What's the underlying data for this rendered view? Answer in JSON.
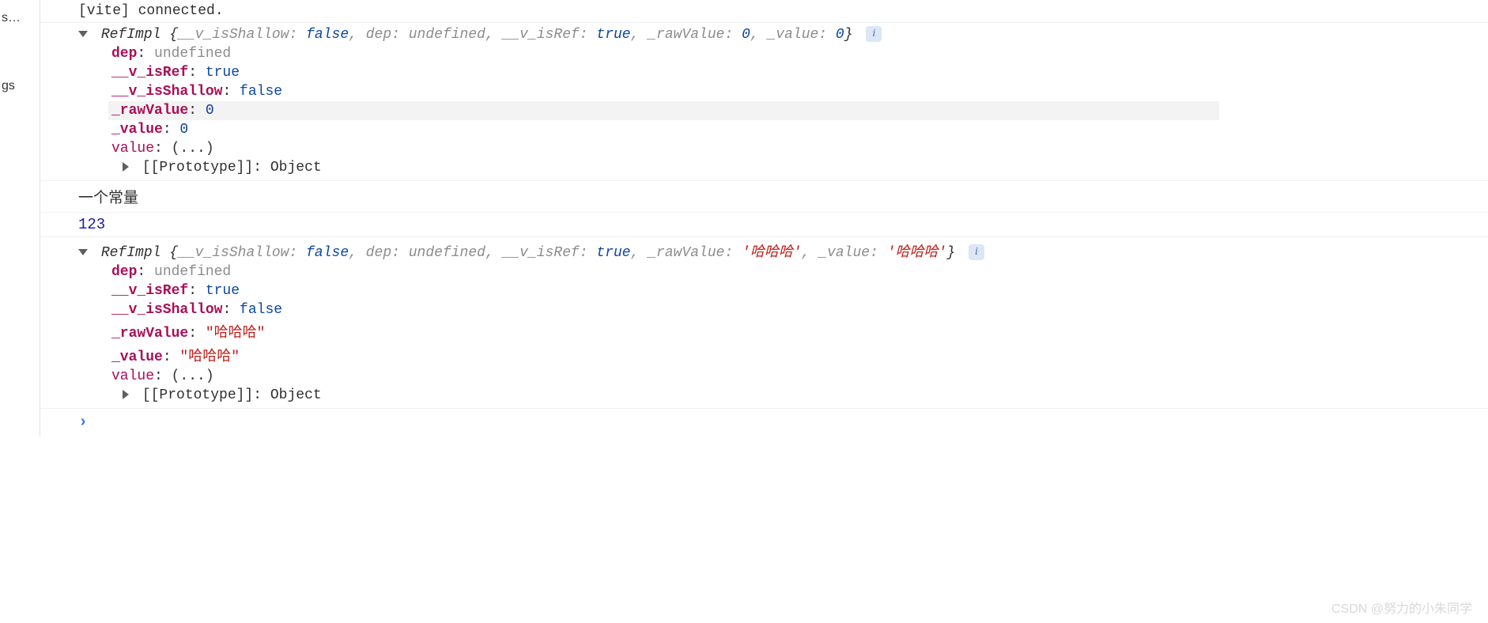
{
  "sidebar": {
    "label_top": "s…",
    "label_mid": "gs"
  },
  "log1": {
    "text": "[vite] connected."
  },
  "obj1": {
    "class_name": "RefImpl",
    "preview": [
      {
        "k": "__v_isShallow",
        "v": "false",
        "cls": "bool"
      },
      {
        "k": "dep",
        "v": "undefined",
        "cls": "undef"
      },
      {
        "k": "__v_isRef",
        "v": "true",
        "cls": "bool"
      },
      {
        "k": "_rawValue",
        "v": "0",
        "cls": "num"
      },
      {
        "k": "_value",
        "v": "0",
        "cls": "num"
      }
    ],
    "props": {
      "dep": {
        "v": "undefined",
        "cls": "undef"
      },
      "v_isRef": {
        "k": "__v_isRef",
        "v": "true",
        "cls": "bool"
      },
      "v_isShallow": {
        "k": "__v_isShallow",
        "v": "false",
        "cls": "bool"
      },
      "rawValue": {
        "k": "_rawValue",
        "v": "0",
        "cls": "num"
      },
      "value": {
        "k": "_value",
        "v": "0",
        "cls": "num"
      },
      "getter": {
        "k": "value",
        "v": "(...)"
      }
    },
    "proto": {
      "label": "[[Prototype]]",
      "v": "Object"
    }
  },
  "plain1": {
    "text": "一个常量"
  },
  "numlog": {
    "text": "123"
  },
  "obj2": {
    "class_name": "RefImpl",
    "preview": [
      {
        "k": "__v_isShallow",
        "v": "false",
        "cls": "bool"
      },
      {
        "k": "dep",
        "v": "undefined",
        "cls": "undef"
      },
      {
        "k": "__v_isRef",
        "v": "true",
        "cls": "bool"
      },
      {
        "k": "_rawValue",
        "v": "'哈哈哈'",
        "cls": "str"
      },
      {
        "k": "_value",
        "v": "'哈哈哈'",
        "cls": "str"
      }
    ],
    "props": {
      "dep": {
        "v": "undefined",
        "cls": "undef"
      },
      "v_isRef": {
        "k": "__v_isRef",
        "v": "true",
        "cls": "bool"
      },
      "v_isShallow": {
        "k": "__v_isShallow",
        "v": "false",
        "cls": "bool"
      },
      "rawValue": {
        "k": "_rawValue",
        "v": "\"哈哈哈\"",
        "cls": "str"
      },
      "value": {
        "k": "_value",
        "v": "\"哈哈哈\"",
        "cls": "str"
      },
      "getter": {
        "k": "value",
        "v": "(...)"
      }
    },
    "proto": {
      "label": "[[Prototype]]",
      "v": "Object"
    }
  },
  "prompt": {
    "caret": "›"
  },
  "watermark": "CSDN @努力的小朱同学",
  "info_glyph": "i"
}
